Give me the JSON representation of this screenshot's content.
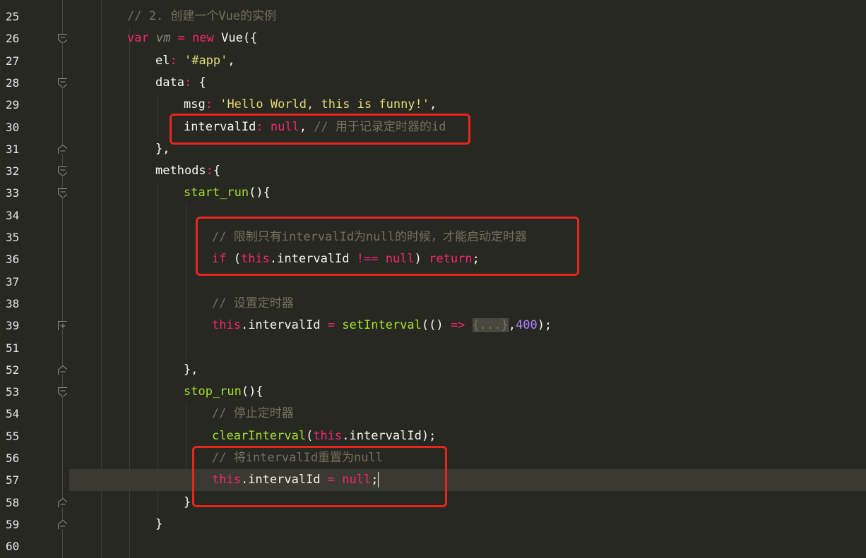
{
  "editor": {
    "lines": [
      {
        "num": "25",
        "fold": "none",
        "indent": 180,
        "tokens": [
          {
            "c": "cm",
            "t": "// 2. 创建一个Vue的实例"
          }
        ]
      },
      {
        "num": "26",
        "fold": "open",
        "indent": 180,
        "tokens": [
          {
            "c": "kw",
            "t": "var "
          },
          {
            "c": "it",
            "t": "vm"
          },
          {
            "c": "op",
            "t": " = "
          },
          {
            "c": "kw",
            "t": "new "
          },
          {
            "c": "id",
            "t": "Vue({"
          }
        ]
      },
      {
        "num": "27",
        "fold": "none",
        "indent": 220,
        "tokens": [
          {
            "c": "id",
            "t": "el"
          },
          {
            "c": "op",
            "t": ": "
          },
          {
            "c": "str",
            "t": "'#app'"
          },
          {
            "c": "id",
            "t": ","
          }
        ]
      },
      {
        "num": "28",
        "fold": "open",
        "indent": 220,
        "tokens": [
          {
            "c": "id",
            "t": "data"
          },
          {
            "c": "op",
            "t": ": "
          },
          {
            "c": "id",
            "t": "{"
          }
        ]
      },
      {
        "num": "29",
        "fold": "none",
        "indent": 260,
        "tokens": [
          {
            "c": "id",
            "t": "msg"
          },
          {
            "c": "op",
            "t": ": "
          },
          {
            "c": "str",
            "t": "'Hello World, this is funny!'"
          },
          {
            "c": "id",
            "t": ","
          }
        ]
      },
      {
        "num": "30",
        "fold": "none",
        "indent": 260,
        "tokens": [
          {
            "c": "id",
            "t": "intervalId"
          },
          {
            "c": "op",
            "t": ": "
          },
          {
            "c": "kw",
            "t": "null"
          },
          {
            "c": "id",
            "t": ", "
          },
          {
            "c": "cm",
            "t": "// 用于记录定时器的id"
          }
        ]
      },
      {
        "num": "31",
        "fold": "close",
        "indent": 220,
        "tokens": [
          {
            "c": "id",
            "t": "},"
          }
        ]
      },
      {
        "num": "32",
        "fold": "open",
        "indent": 220,
        "tokens": [
          {
            "c": "id",
            "t": "methods"
          },
          {
            "c": "op",
            "t": ":"
          },
          {
            "c": "id",
            "t": "{"
          }
        ]
      },
      {
        "num": "33",
        "fold": "open",
        "indent": 260,
        "tokens": [
          {
            "c": "fn",
            "t": "start_run"
          },
          {
            "c": "id",
            "t": "(){"
          }
        ]
      },
      {
        "num": "34",
        "fold": "none",
        "indent": 300,
        "tokens": []
      },
      {
        "num": "35",
        "fold": "none",
        "indent": 300,
        "tokens": [
          {
            "c": "cm",
            "t": "// 限制只有intervalId为null的时候，才能启动定时器"
          }
        ]
      },
      {
        "num": "36",
        "fold": "none",
        "indent": 300,
        "tokens": [
          {
            "c": "kw",
            "t": "if "
          },
          {
            "c": "id",
            "t": "("
          },
          {
            "c": "kw",
            "t": "this"
          },
          {
            "c": "id",
            "t": ".intervalId "
          },
          {
            "c": "op",
            "t": "!== "
          },
          {
            "c": "kw",
            "t": "null"
          },
          {
            "c": "id",
            "t": ") "
          },
          {
            "c": "kw",
            "t": "return"
          },
          {
            "c": "id",
            "t": ";"
          }
        ]
      },
      {
        "num": "37",
        "fold": "none",
        "indent": 300,
        "tokens": []
      },
      {
        "num": "38",
        "fold": "none",
        "indent": 300,
        "tokens": [
          {
            "c": "cm",
            "t": "// 设置定时器"
          }
        ]
      },
      {
        "num": "39",
        "fold": "plus",
        "indent": 300,
        "tokens": [
          {
            "c": "kw",
            "t": "this"
          },
          {
            "c": "id",
            "t": ".intervalId "
          },
          {
            "c": "op",
            "t": "= "
          },
          {
            "c": "fn",
            "t": "setInterval"
          },
          {
            "c": "id",
            "t": "(() "
          },
          {
            "c": "op",
            "t": "=> "
          },
          {
            "c": "collapsed",
            "t": "{...}"
          },
          {
            "c": "id",
            "t": ","
          },
          {
            "c": "num",
            "t": "400"
          },
          {
            "c": "id",
            "t": ");"
          }
        ]
      },
      {
        "num": "51",
        "fold": "none",
        "indent": 300,
        "tokens": []
      },
      {
        "num": "52",
        "fold": "close",
        "indent": 260,
        "tokens": [
          {
            "c": "id",
            "t": "},"
          }
        ]
      },
      {
        "num": "53",
        "fold": "open",
        "indent": 260,
        "tokens": [
          {
            "c": "fn",
            "t": "stop_run"
          },
          {
            "c": "id",
            "t": "(){"
          }
        ]
      },
      {
        "num": "54",
        "fold": "none",
        "indent": 300,
        "tokens": [
          {
            "c": "cm",
            "t": "// 停止定时器"
          }
        ]
      },
      {
        "num": "55",
        "fold": "none",
        "indent": 300,
        "tokens": [
          {
            "c": "fn",
            "t": "clearInterval"
          },
          {
            "c": "id",
            "t": "("
          },
          {
            "c": "kw",
            "t": "this"
          },
          {
            "c": "id",
            "t": ".intervalId);"
          }
        ]
      },
      {
        "num": "56",
        "fold": "none",
        "indent": 300,
        "tokens": [
          {
            "c": "cm",
            "t": "// 将intervalId重置为null"
          }
        ]
      },
      {
        "num": "57",
        "fold": "none",
        "indent": 300,
        "current": true,
        "tokens": [
          {
            "c": "kw",
            "t": "this"
          },
          {
            "c": "id",
            "t": ".intervalId "
          },
          {
            "c": "op",
            "t": "= "
          },
          {
            "c": "kw",
            "t": "null"
          },
          {
            "c": "id",
            "t": ";"
          },
          {
            "c": "caret",
            "t": ""
          }
        ]
      },
      {
        "num": "58",
        "fold": "close",
        "indent": 260,
        "tokens": [
          {
            "c": "id",
            "t": "}"
          }
        ]
      },
      {
        "num": "59",
        "fold": "close",
        "indent": 220,
        "tokens": [
          {
            "c": "id",
            "t": "}"
          }
        ]
      },
      {
        "num": "60",
        "fold": "none",
        "indent": 180,
        "tokens": []
      }
    ]
  },
  "colors": {
    "background": "#272822",
    "highlight": "#e8261f"
  }
}
